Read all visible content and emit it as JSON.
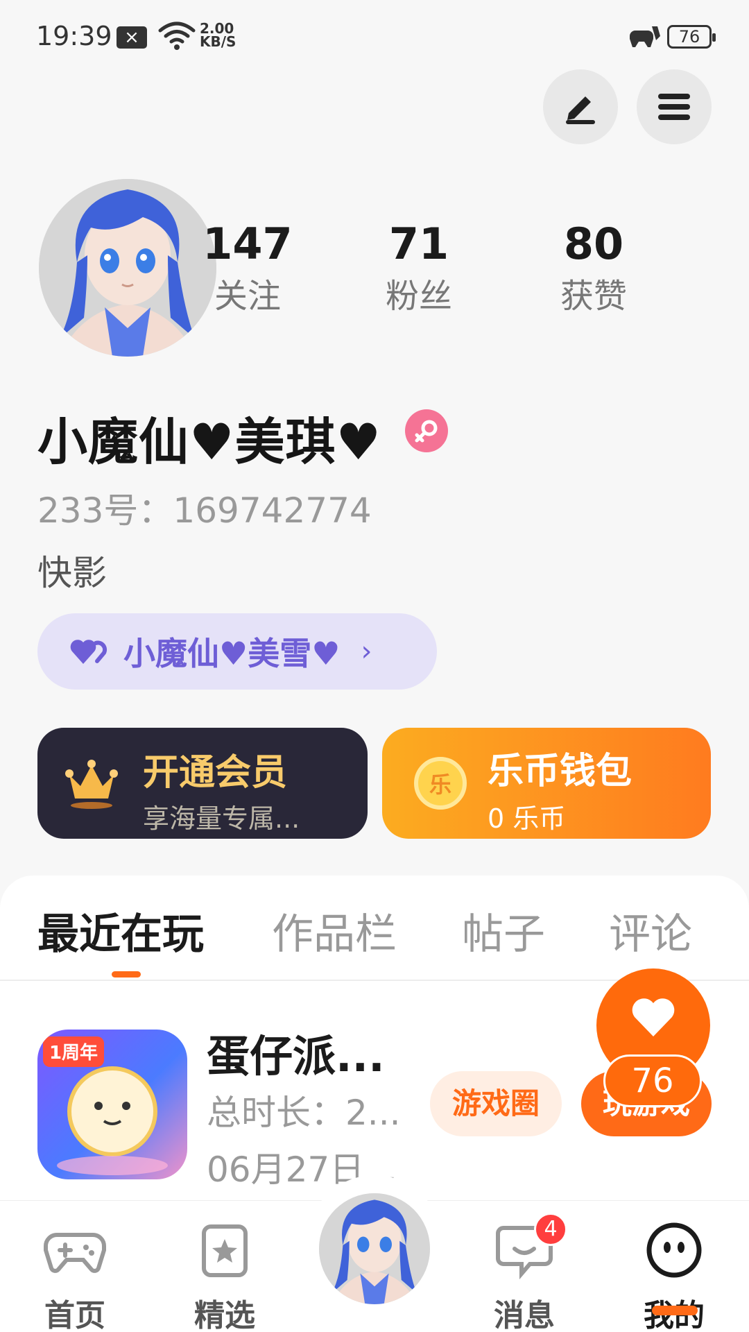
{
  "status_bar": {
    "time": "19:39",
    "notification_icon": "close-box-icon",
    "speed": "2.00",
    "speed_unit": "KB/S",
    "battery": "76"
  },
  "header": {
    "edit_icon": "edit-icon",
    "menu_icon": "menu-icon"
  },
  "profile": {
    "stats": [
      {
        "value": "147",
        "label": "关注"
      },
      {
        "value": "71",
        "label": "粉丝"
      },
      {
        "value": "80",
        "label": "获赞"
      }
    ],
    "username": "小魔仙♥美琪♥",
    "gender": "female",
    "uid": "233号：169742774",
    "bio": "快影",
    "cp_label": "小魔仙♥美雪♥"
  },
  "cards": {
    "vip_title": "开通会员",
    "vip_sub": "享海量专属...",
    "wallet_title": "乐币钱包",
    "wallet_sub": "0 乐币",
    "coin_char": "乐"
  },
  "tabs": [
    "最近在玩",
    "作品栏",
    "帖子",
    "评论"
  ],
  "active_tab": 0,
  "recent_game": {
    "name": "蛋仔派...",
    "duration": "总时长：2...",
    "date": "06月27日...",
    "circle_button": "游戏圈",
    "play_button": "玩游戏",
    "badge_text": "1周年"
  },
  "floating_like": {
    "count": "76"
  },
  "bottom_nav": {
    "items": [
      {
        "label": "首页",
        "icon": "gamepad-icon"
      },
      {
        "label": "精选",
        "icon": "star-bookmark-icon"
      },
      {
        "label": "",
        "icon": "avatar"
      },
      {
        "label": "消息",
        "icon": "chat-bubble-icon"
      },
      {
        "label": "我的",
        "icon": "smiley-face-icon"
      }
    ],
    "message_badge": "4"
  },
  "colors": {
    "accent": "#ff6a17",
    "vip_gold": "#f8cb6b",
    "cp_purple": "#6e5ed6",
    "gender_pink": "#f57395"
  }
}
